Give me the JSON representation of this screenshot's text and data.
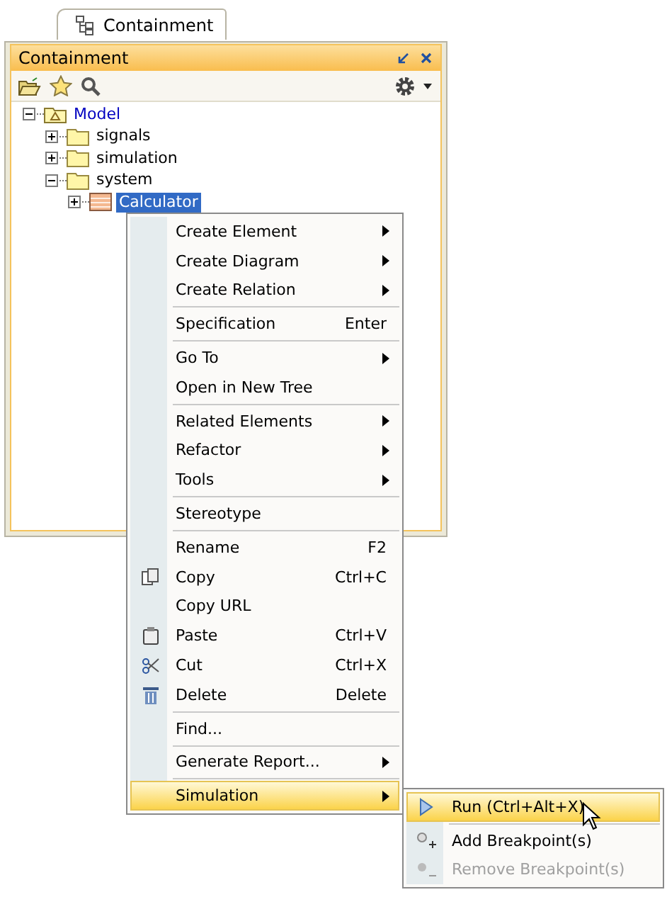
{
  "tab": {
    "label": "Containment",
    "selected": true
  },
  "panel": {
    "title": "Containment"
  },
  "tree": [
    {
      "label": "Model",
      "kind": "model",
      "expanded": true,
      "selected": false,
      "children": [
        {
          "label": "signals",
          "kind": "folder",
          "expanded": false,
          "selected": false
        },
        {
          "label": "simulation",
          "kind": "folder",
          "expanded": false,
          "selected": false
        },
        {
          "label": "system",
          "kind": "folder",
          "expanded": true,
          "selected": false,
          "children": [
            {
              "label": "Calculator",
              "kind": "block",
              "expanded": false,
              "selected": true
            }
          ]
        }
      ]
    }
  ],
  "menu": [
    {
      "kind": "plain",
      "label": "Create Element",
      "submenu": true,
      "selected": false
    },
    {
      "kind": "plain",
      "label": "Create Diagram",
      "submenu": true,
      "selected": false
    },
    {
      "kind": "plain",
      "label": "Create Relation",
      "submenu": true,
      "selected": false
    },
    {
      "kind": "separator"
    },
    {
      "kind": "plain",
      "label": "Specification",
      "shortcut": "Enter",
      "selected": false
    },
    {
      "kind": "separator"
    },
    {
      "kind": "plain",
      "label": "Go To",
      "submenu": true,
      "selected": false
    },
    {
      "kind": "plain",
      "label": "Open in New Tree",
      "selected": false
    },
    {
      "kind": "separator"
    },
    {
      "kind": "plain",
      "label": "Related Elements",
      "submenu": true,
      "selected": false
    },
    {
      "kind": "plain",
      "label": "Refactor",
      "submenu": true,
      "selected": false
    },
    {
      "kind": "plain",
      "label": "Tools",
      "submenu": true,
      "selected": false
    },
    {
      "kind": "separator"
    },
    {
      "kind": "plain",
      "label": "Stereotype",
      "selected": false
    },
    {
      "kind": "separator"
    },
    {
      "kind": "plain",
      "label": "Rename",
      "shortcut": "F2",
      "selected": false
    },
    {
      "kind": "copy",
      "label": "Copy",
      "shortcut": "Ctrl+C",
      "selected": false
    },
    {
      "kind": "plain",
      "label": "Copy URL",
      "selected": false
    },
    {
      "kind": "paste",
      "label": "Paste",
      "shortcut": "Ctrl+V",
      "selected": false
    },
    {
      "kind": "cut",
      "label": "Cut",
      "shortcut": "Ctrl+X",
      "selected": false
    },
    {
      "kind": "delete",
      "label": "Delete",
      "shortcut": "Delete",
      "selected": false
    },
    {
      "kind": "separator"
    },
    {
      "kind": "plain",
      "label": "Find...",
      "selected": false
    },
    {
      "kind": "separator"
    },
    {
      "kind": "plain",
      "label": "Generate Report...",
      "submenu": true,
      "selected": false
    },
    {
      "kind": "separator"
    },
    {
      "kind": "plain",
      "label": "Simulation",
      "submenu": true,
      "selected": true
    }
  ],
  "submenu": [
    {
      "kind": "run",
      "label": "Run (Ctrl+Alt+X)",
      "selected": true,
      "disabled": false
    },
    {
      "kind": "separator"
    },
    {
      "kind": "add-breakpoint",
      "label": "Add Breakpoint(s)",
      "selected": false,
      "disabled": false
    },
    {
      "kind": "remove-breakpoint",
      "label": "Remove Breakpoint(s)",
      "selected": false,
      "disabled": true
    }
  ]
}
